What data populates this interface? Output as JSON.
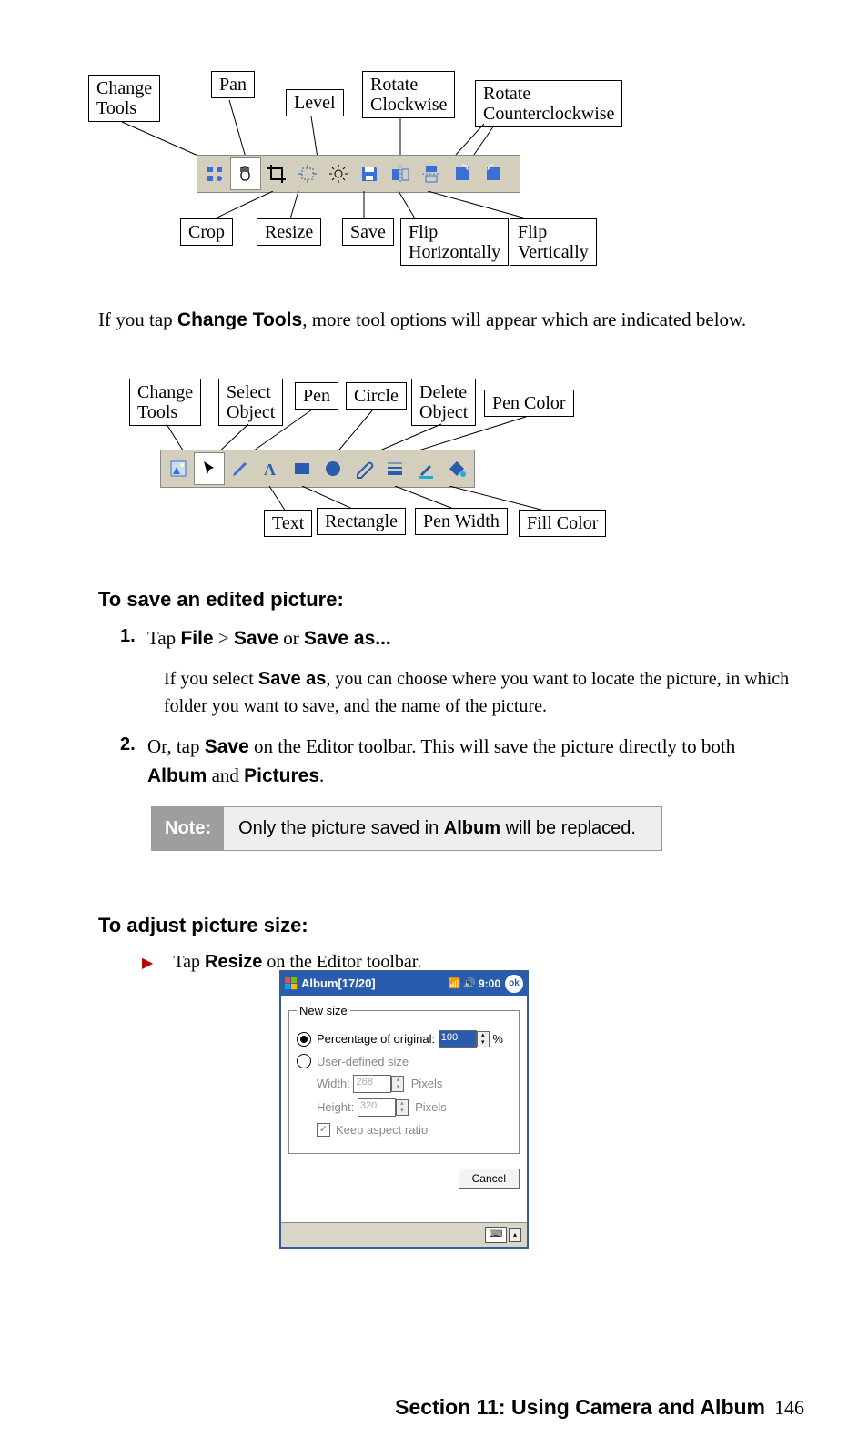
{
  "toolbar1": {
    "top_labels": {
      "change_tools": "Change\nTools",
      "pan": "Pan",
      "level": "Level",
      "rotate_cw": "Rotate\nClockwise",
      "rotate_ccw": "Rotate\nCounterclockwise"
    },
    "bottom_labels": {
      "crop": "Crop",
      "resize": "Resize",
      "save": "Save",
      "flip_h": "Flip\nHorizontally",
      "flip_v": "Flip\nVertically"
    }
  },
  "intro": {
    "pre": "If you tap ",
    "bold": "Change Tools",
    "post": ", more tool options will appear which are indicated below."
  },
  "toolbar2": {
    "top_labels": {
      "change_tools": "Change\nTools",
      "select_obj": "Select\nObject",
      "pen": "Pen",
      "circle": "Circle",
      "delete_obj": "Delete\nObject",
      "pen_color": "Pen Color"
    },
    "bottom_labels": {
      "text": "Text",
      "rectangle": "Rectangle",
      "pen_width": "Pen Width",
      "fill_color": "Fill Color"
    }
  },
  "save_section": {
    "heading": "To save an edited picture:",
    "step1": {
      "num": "1.",
      "pre": "Tap ",
      "file": "File",
      "gt": " > ",
      "save": "Save",
      "or": " or ",
      "saveas": "Save as..."
    },
    "sub": {
      "pre": "If you select ",
      "b": "Save as",
      "post": ", you can choose where you want to locate the picture, in which folder you want to save, and the name of the picture."
    },
    "step2": {
      "num": "2.",
      "pre": "Or, tap ",
      "b1": "Save",
      "mid": " on the Editor toolbar.  This will save the picture directly to both ",
      "b2": "Album",
      "and": " and ",
      "b3": "Pictures",
      "end": "."
    },
    "note": {
      "tag": "Note:",
      "pre": "Only the picture saved in ",
      "b": "Album",
      "post": " will be replaced."
    }
  },
  "adjust": {
    "heading": "To adjust picture size:",
    "bullet": {
      "pre": "Tap ",
      "b": "Resize",
      "post": " on the Editor toolbar."
    }
  },
  "dialog": {
    "title": "Album[17/20]",
    "time": "9:00",
    "ok": "ok",
    "legend": "New size",
    "opt1": "Percentage of original:",
    "pct": "100",
    "pct_unit": "%",
    "opt2": "User-defined size",
    "width_lbl": "Width:",
    "width_val": "268",
    "px": "Pixels",
    "height_lbl": "Height:",
    "height_val": "320",
    "keep": "Keep aspect ratio",
    "cancel": "Cancel"
  },
  "footer": {
    "section": "Section 11: Using Camera and Album",
    "page": "146"
  }
}
